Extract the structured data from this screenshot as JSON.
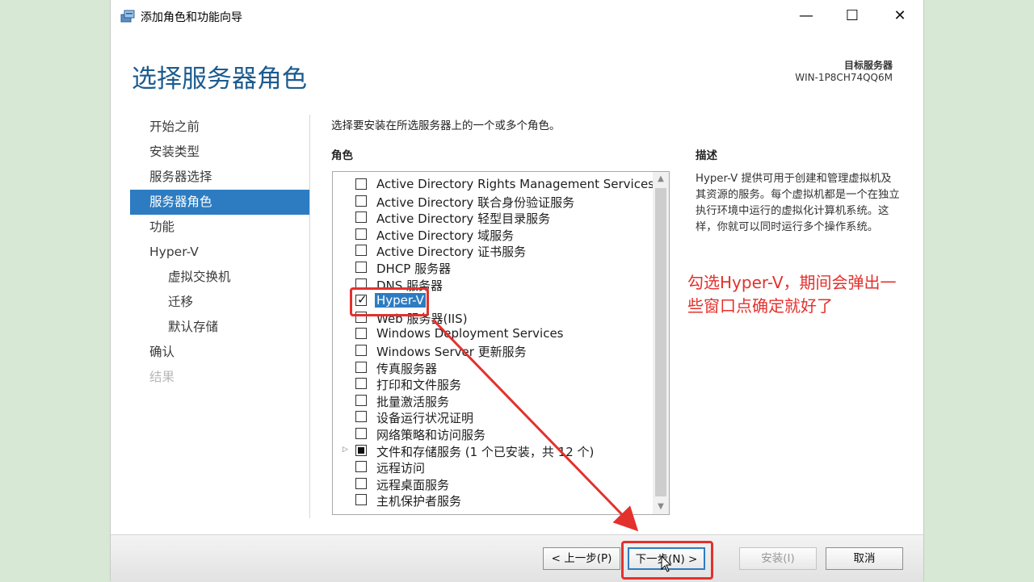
{
  "window": {
    "title": "添加角色和功能向导",
    "controls": {
      "minimize": "—",
      "maximize": "☐",
      "close": "✕"
    }
  },
  "header": {
    "page_title": "选择服务器角色",
    "target_label": "目标服务器",
    "target_value": "WIN-1P8CH74QQ6M"
  },
  "nav": {
    "items": [
      {
        "label": "开始之前",
        "state": "normal"
      },
      {
        "label": "安装类型",
        "state": "normal"
      },
      {
        "label": "服务器选择",
        "state": "normal"
      },
      {
        "label": "服务器角色",
        "state": "active"
      },
      {
        "label": "功能",
        "state": "normal"
      },
      {
        "label": "Hyper-V",
        "state": "normal"
      },
      {
        "label": "虚拟交换机",
        "state": "sub"
      },
      {
        "label": "迁移",
        "state": "sub"
      },
      {
        "label": "默认存储",
        "state": "sub"
      },
      {
        "label": "确认",
        "state": "normal"
      },
      {
        "label": "结果",
        "state": "disabled"
      }
    ]
  },
  "main": {
    "instruction": "选择要安装在所选服务器上的一个或多个角色。",
    "roles_header": "角色",
    "roles": [
      {
        "label": "Active Directory Rights Management Services",
        "state": "unchecked"
      },
      {
        "label": "Active Directory 联合身份验证服务",
        "state": "unchecked"
      },
      {
        "label": "Active Directory 轻型目录服务",
        "state": "unchecked"
      },
      {
        "label": "Active Directory 域服务",
        "state": "unchecked"
      },
      {
        "label": "Active Directory 证书服务",
        "state": "unchecked"
      },
      {
        "label": "DHCP 服务器",
        "state": "unchecked"
      },
      {
        "label": "DNS 服务器",
        "state": "unchecked"
      },
      {
        "label": "Hyper-V",
        "state": "checked",
        "selected": true
      },
      {
        "label": "Web 服务器(IIS)",
        "state": "unchecked"
      },
      {
        "label": "Windows Deployment Services",
        "state": "unchecked"
      },
      {
        "label": "Windows Server 更新服务",
        "state": "unchecked"
      },
      {
        "label": "传真服务器",
        "state": "unchecked"
      },
      {
        "label": "打印和文件服务",
        "state": "unchecked"
      },
      {
        "label": "批量激活服务",
        "state": "unchecked"
      },
      {
        "label": "设备运行状况证明",
        "state": "unchecked"
      },
      {
        "label": "网络策略和访问服务",
        "state": "unchecked"
      },
      {
        "label": "文件和存储服务 (1 个已安装，共 12 个)",
        "state": "partial",
        "expandable": true
      },
      {
        "label": "远程访问",
        "state": "unchecked"
      },
      {
        "label": "远程桌面服务",
        "state": "unchecked"
      },
      {
        "label": "主机保护者服务",
        "state": "unchecked"
      }
    ],
    "description_header": "描述",
    "description_text": "Hyper-V 提供可用于创建和管理虚拟机及其资源的服务。每个虚拟机都是一个在独立执行环境中运行的虚拟化计算机系统。这样，你就可以同时运行多个操作系统。"
  },
  "annotation": {
    "text": "勾选Hyper-V，期间会弹出一些窗口点确定就好了",
    "color": "#e3312d"
  },
  "footer": {
    "prev_label": "< 上一步(P)",
    "next_label": "下一步(N) >",
    "install_label": "安装(I)",
    "cancel_label": "取消"
  },
  "colors": {
    "accent": "#2d7cc2",
    "title_blue": "#1c5b8f",
    "annotation_red": "#e3312d"
  }
}
